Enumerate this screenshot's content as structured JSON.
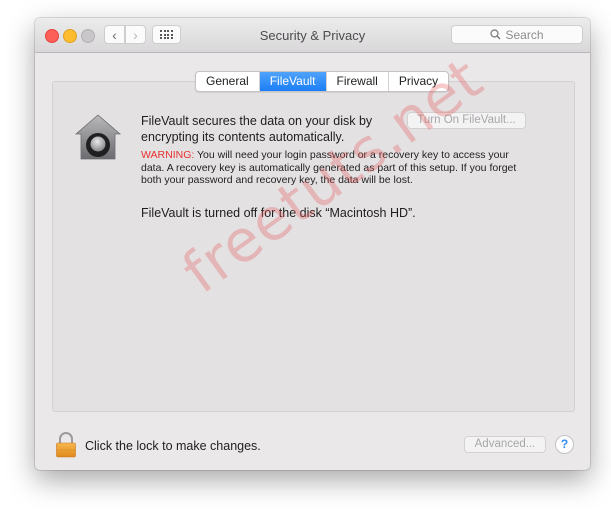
{
  "window": {
    "title": "Security & Privacy",
    "search_placeholder": "Search",
    "nav": {
      "back_icon": "chevron-left-icon",
      "forward_icon": "chevron-right-icon",
      "grid_icon": "show-all-grid-icon"
    }
  },
  "tabs": [
    {
      "label": "General",
      "active": false
    },
    {
      "label": "FileVault",
      "active": true
    },
    {
      "label": "Firewall",
      "active": false
    },
    {
      "label": "Privacy",
      "active": false
    }
  ],
  "filevault": {
    "description": "FileVault secures the data on your disk by encrypting its contents automatically.",
    "turn_on_button": "Turn On FileVault...",
    "warning_label": "WARNING:",
    "warning_text": " You will need your login password or a recovery key to access your data. A recovery key is automatically generated as part of this setup. If you forget both your password and recovery key, the data will be lost.",
    "status": "FileVault is turned off for the disk “Macintosh HD”."
  },
  "footer": {
    "lock_text": "Click the lock to make changes.",
    "advanced_button": "Advanced...",
    "help_label": "?"
  },
  "watermark": "freetuts.net",
  "colors": {
    "accent": "#1b7ef5",
    "warning": "#e8302c",
    "close": "#fc5f57",
    "minimize": "#fdbc2e"
  }
}
